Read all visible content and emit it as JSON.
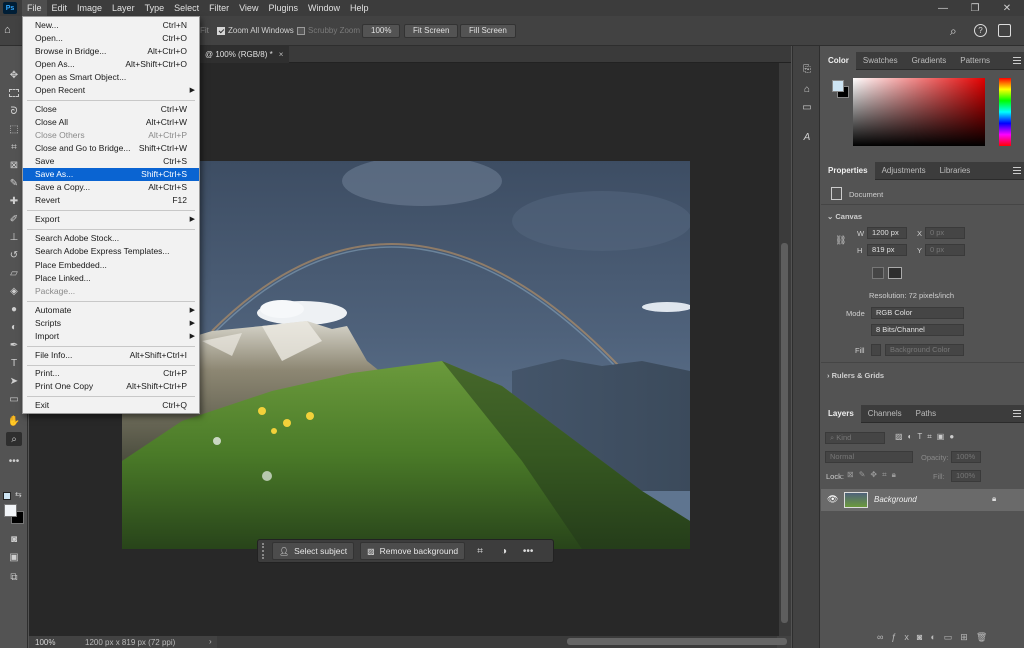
{
  "menubar": {
    "logo": "Ps",
    "items": [
      "File",
      "Edit",
      "Image",
      "Layer",
      "Type",
      "Select",
      "Filter",
      "View",
      "Plugins",
      "Window",
      "Help"
    ],
    "active": "File"
  },
  "options": {
    "fit_fragment": "Fit",
    "zoom_all_windows": "Zoom All Windows",
    "scrubby_zoom": "Scrubby Zoom",
    "zoom_value": "100%",
    "fit_screen": "Fit Screen",
    "fill_screen": "Fill Screen"
  },
  "document": {
    "tab_title": "@ 100% (RGB/8) *",
    "close": "×"
  },
  "status": {
    "zoom": "100%",
    "info": "1200 px x 819 px (72 ppi)"
  },
  "context_bar": {
    "select_subject": "Select subject",
    "remove_background": "Remove background",
    "more": "•••"
  },
  "file_menu": {
    "items": [
      {
        "label": "New...",
        "shortcut": "Ctrl+N"
      },
      {
        "label": "Open...",
        "shortcut": "Ctrl+O"
      },
      {
        "label": "Browse in Bridge...",
        "shortcut": "Alt+Ctrl+O"
      },
      {
        "label": "Open As...",
        "shortcut": "Alt+Shift+Ctrl+O"
      },
      {
        "label": "Open as Smart Object...",
        "shortcut": ""
      },
      {
        "label": "Open Recent",
        "shortcut": "",
        "submenu": true
      },
      {
        "label": "Close",
        "shortcut": "Ctrl+W"
      },
      {
        "label": "Close All",
        "shortcut": "Alt+Ctrl+W"
      },
      {
        "label": "Close Others",
        "shortcut": "Alt+Ctrl+P",
        "disabled": true
      },
      {
        "label": "Close and Go to Bridge...",
        "shortcut": "Shift+Ctrl+W"
      },
      {
        "label": "Save",
        "shortcut": "Ctrl+S"
      },
      {
        "label": "Save As...",
        "shortcut": "Shift+Ctrl+S",
        "highlighted": true
      },
      {
        "label": "Save a Copy...",
        "shortcut": "Alt+Ctrl+S"
      },
      {
        "label": "Revert",
        "shortcut": "F12"
      },
      {
        "label": "Export",
        "shortcut": "",
        "submenu": true
      },
      {
        "label": "Search Adobe Stock...",
        "shortcut": ""
      },
      {
        "label": "Search Adobe Express Templates...",
        "shortcut": ""
      },
      {
        "label": "Place Embedded...",
        "shortcut": ""
      },
      {
        "label": "Place Linked...",
        "shortcut": ""
      },
      {
        "label": "Package...",
        "shortcut": "",
        "disabled": true
      },
      {
        "label": "Automate",
        "shortcut": "",
        "submenu": true
      },
      {
        "label": "Scripts",
        "shortcut": "",
        "submenu": true
      },
      {
        "label": "Import",
        "shortcut": "",
        "submenu": true
      },
      {
        "label": "File Info...",
        "shortcut": "Alt+Shift+Ctrl+I"
      },
      {
        "label": "Print...",
        "shortcut": "Ctrl+P"
      },
      {
        "label": "Print One Copy",
        "shortcut": "Alt+Shift+Ctrl+P"
      },
      {
        "label": "Exit",
        "shortcut": "Ctrl+Q"
      }
    ]
  },
  "color_panel": {
    "tabs": [
      "Color",
      "Swatches",
      "Gradients",
      "Patterns"
    ],
    "active": "Color",
    "foreground": "#cde4f3",
    "background": "#000000"
  },
  "properties_panel": {
    "tabs": [
      "Properties",
      "Adjustments",
      "Libraries"
    ],
    "active": "Properties",
    "doc_label": "Document",
    "canvas_header": "Canvas",
    "w_label": "W",
    "w_value": "1200 px",
    "h_label": "H",
    "h_value": "819 px",
    "x_label": "X",
    "x_value": "0 px",
    "y_label": "Y",
    "y_value": "0 px",
    "resolution": "Resolution: 72 pixels/inch",
    "mode_label": "Mode",
    "mode_value": "RGB Color",
    "bits_value": "8 Bits/Channel",
    "fill_label": "Fill",
    "fill_value": "Background Color",
    "rulers_header": "Rulers & Grids"
  },
  "layers_panel": {
    "tabs": [
      "Layers",
      "Channels",
      "Paths"
    ],
    "active": "Layers",
    "kind_placeholder": "Kind",
    "blend_mode": "Normal",
    "opacity_label": "Opacity:",
    "opacity_value": "100%",
    "lock_label": "Lock:",
    "fill_label": "Fill:",
    "fill_value": "100%",
    "layer_name": "Background"
  }
}
